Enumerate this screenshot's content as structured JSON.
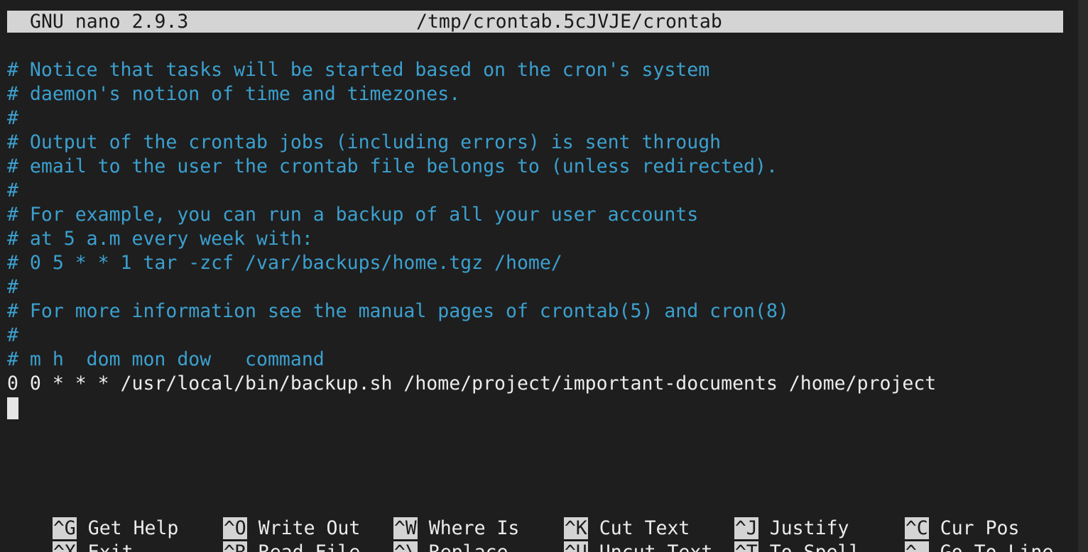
{
  "titlebar": {
    "app_version": "GNU nano 2.9.3",
    "filename": "/tmp/crontab.5cJVJE/crontab"
  },
  "editor": {
    "lines": [
      {
        "text": "# Notice that tasks will be started based on the cron's system",
        "kind": "comment"
      },
      {
        "text": "# daemon's notion of time and timezones.",
        "kind": "comment"
      },
      {
        "text": "#",
        "kind": "comment"
      },
      {
        "text": "# Output of the crontab jobs (including errors) is sent through",
        "kind": "comment"
      },
      {
        "text": "# email to the user the crontab file belongs to (unless redirected).",
        "kind": "comment"
      },
      {
        "text": "#",
        "kind": "comment"
      },
      {
        "text": "# For example, you can run a backup of all your user accounts",
        "kind": "comment"
      },
      {
        "text": "# at 5 a.m every week with:",
        "kind": "comment"
      },
      {
        "text": "# 0 5 * * 1 tar -zcf /var/backups/home.tgz /home/",
        "kind": "comment"
      },
      {
        "text": "#",
        "kind": "comment"
      },
      {
        "text": "# For more information see the manual pages of crontab(5) and cron(8)",
        "kind": "comment"
      },
      {
        "text": "#",
        "kind": "comment"
      },
      {
        "text": "# m h  dom mon dow   command",
        "kind": "comment"
      },
      {
        "text": "0 0 * * * /usr/local/bin/backup.sh /home/project/important-documents /home/project",
        "kind": "code"
      },
      {
        "text": "",
        "kind": "cursor"
      }
    ]
  },
  "shortcuts": [
    {
      "key": "^G",
      "label": "Get Help"
    },
    {
      "key": "^O",
      "label": "Write Out"
    },
    {
      "key": "^W",
      "label": "Where Is"
    },
    {
      "key": "^K",
      "label": "Cut Text"
    },
    {
      "key": "^J",
      "label": "Justify"
    },
    {
      "key": "^C",
      "label": "Cur Pos"
    },
    {
      "key": "^X",
      "label": "Exit"
    },
    {
      "key": "^R",
      "label": "Read File"
    },
    {
      "key": "^\\",
      "label": "Replace"
    },
    {
      "key": "^U",
      "label": "Uncut Text"
    },
    {
      "key": "^T",
      "label": "To Spell"
    },
    {
      "key": "^_",
      "label": "Go To Line"
    }
  ],
  "colors": {
    "background": "#1e1e1e",
    "comment": "#3ca0cf",
    "text": "#ececec",
    "bar": "#d4d4d4"
  }
}
